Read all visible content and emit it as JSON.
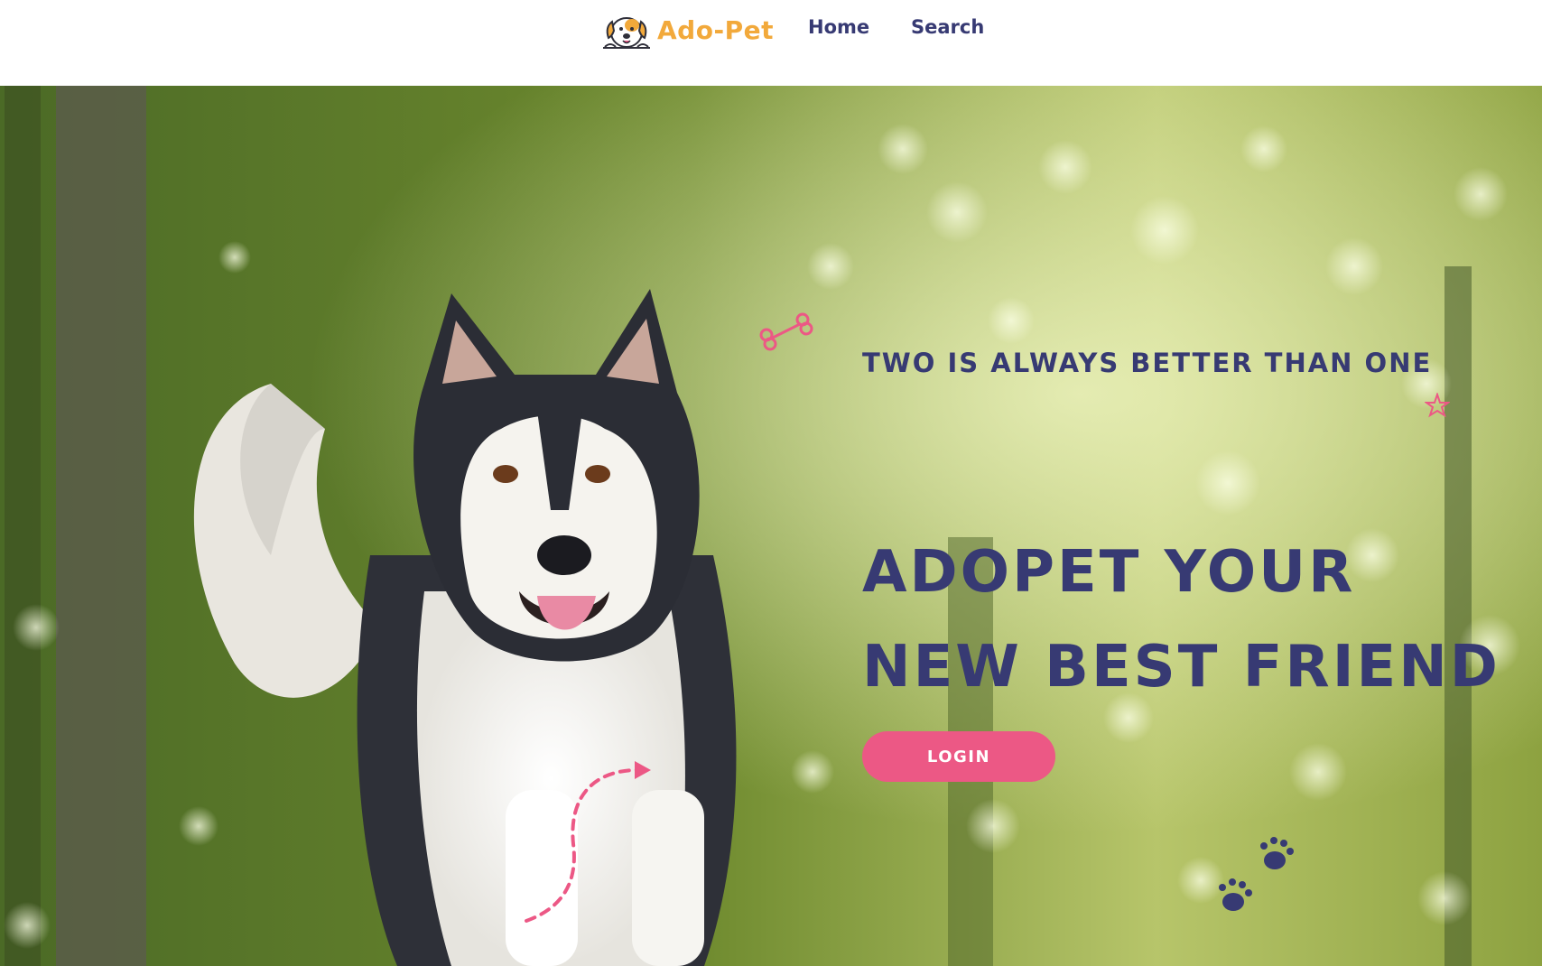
{
  "nav": {
    "brand": "Ado-Pet",
    "links": [
      {
        "label": "Home"
      },
      {
        "label": "Search"
      }
    ]
  },
  "hero": {
    "tagline": "Two is always better than one",
    "headline_line1": "Adopet your",
    "headline_line2": "new best friend",
    "login_label": "LOGIN"
  },
  "colors": {
    "brand": "#f2a93b",
    "navy": "#373a73",
    "accent_pink": "#ec5885",
    "background": "#ffffff"
  },
  "icons": {
    "logo": "dog-face-logo",
    "decor": [
      "bone-icon",
      "star-icon",
      "paw-prints-icon",
      "dashed-arrow-icon"
    ]
  }
}
